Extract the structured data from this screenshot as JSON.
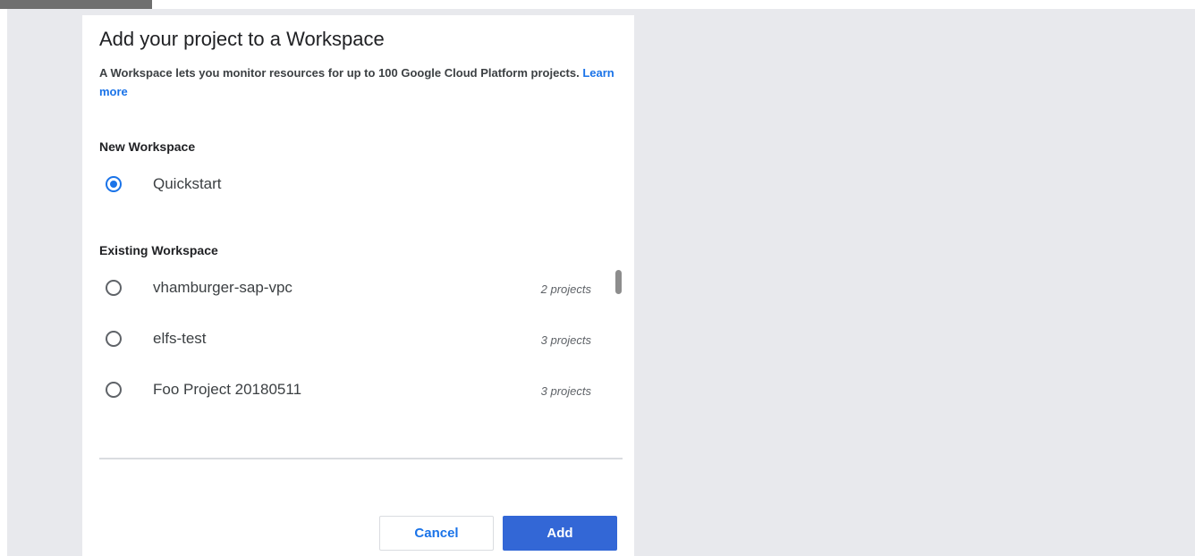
{
  "dialog": {
    "title": "Add your project to a Workspace",
    "description": "A Workspace lets you monitor resources for up to 100 Google Cloud Platform projects.",
    "learn_more": "Learn more",
    "new_workspace": {
      "heading": "New Workspace",
      "option": {
        "label": "Quickstart",
        "selected": true
      }
    },
    "existing_workspace": {
      "heading": "Existing Workspace",
      "options": [
        {
          "label": "vhamburger-sap-vpc",
          "count": "2 projects",
          "selected": false
        },
        {
          "label": "elfs-test",
          "count": "3 projects",
          "selected": false
        },
        {
          "label": "Foo Project 20180511",
          "count": "3 projects",
          "selected": false
        }
      ]
    },
    "buttons": {
      "cancel": "Cancel",
      "add": "Add"
    }
  },
  "colors": {
    "accent": "#1a73e8",
    "primary_button": "#3367d6",
    "backdrop": "#e8e9ed"
  }
}
